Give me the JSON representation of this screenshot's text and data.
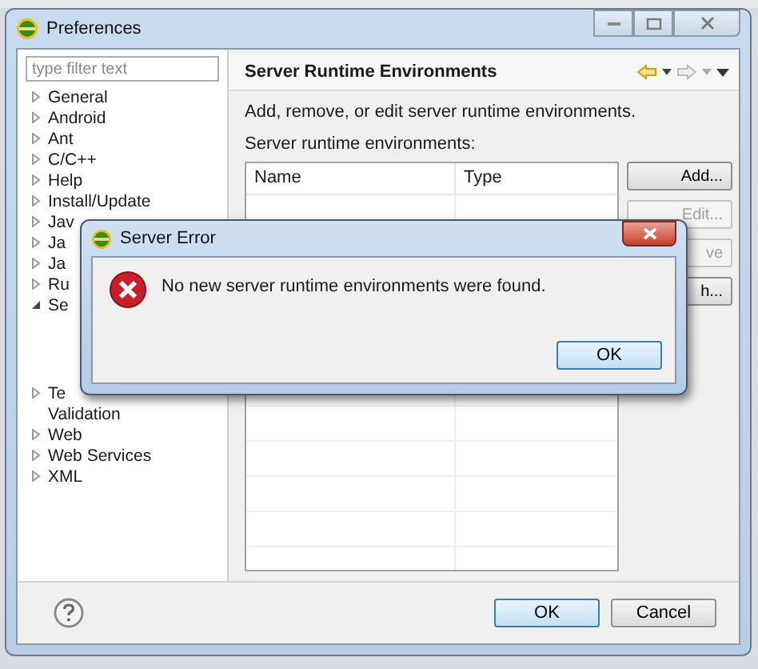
{
  "window": {
    "title": "Preferences"
  },
  "filter": {
    "placeholder": "type filter text"
  },
  "tree": [
    {
      "label": "General",
      "kind": "group",
      "expanded": false
    },
    {
      "label": "Android",
      "kind": "group",
      "expanded": false
    },
    {
      "label": "Ant",
      "kind": "group",
      "expanded": false
    },
    {
      "label": "C/C++",
      "kind": "group",
      "expanded": false
    },
    {
      "label": "Help",
      "kind": "group",
      "expanded": false
    },
    {
      "label": "Install/Update",
      "kind": "group",
      "expanded": false
    },
    {
      "label": "Jav",
      "kind": "group",
      "expanded": false
    },
    {
      "label": "Ja",
      "kind": "group",
      "expanded": false
    },
    {
      "label": "Ja",
      "kind": "group",
      "expanded": false
    },
    {
      "label": "Ru",
      "kind": "group",
      "expanded": false
    },
    {
      "label": "Se",
      "kind": "group",
      "expanded": true
    },
    {
      "label": "Te",
      "kind": "group",
      "expanded": false
    },
    {
      "label": "Validation",
      "kind": "leaf"
    },
    {
      "label": "Web",
      "kind": "group",
      "expanded": false
    },
    {
      "label": "Web Services",
      "kind": "group",
      "expanded": false
    },
    {
      "label": "XML",
      "kind": "group",
      "expanded": false
    }
  ],
  "page": {
    "title": "Server Runtime Environments",
    "description": "Add, remove, or edit server runtime environments.",
    "list_label": "Server runtime environments:"
  },
  "table": {
    "columns": [
      "Name",
      "Type"
    ]
  },
  "side_buttons": [
    {
      "label": "Add...",
      "disabled": false
    },
    {
      "label": "Edit...",
      "disabled": true
    },
    {
      "label": "ve",
      "disabled": true
    },
    {
      "label": "h...",
      "disabled": false
    }
  ],
  "footer_buttons": [
    {
      "label": "OK",
      "default": true
    },
    {
      "label": "Cancel",
      "default": false
    }
  ],
  "dialog": {
    "title": "Server Error",
    "message": "No new server runtime environments were found.",
    "button": "OK"
  }
}
